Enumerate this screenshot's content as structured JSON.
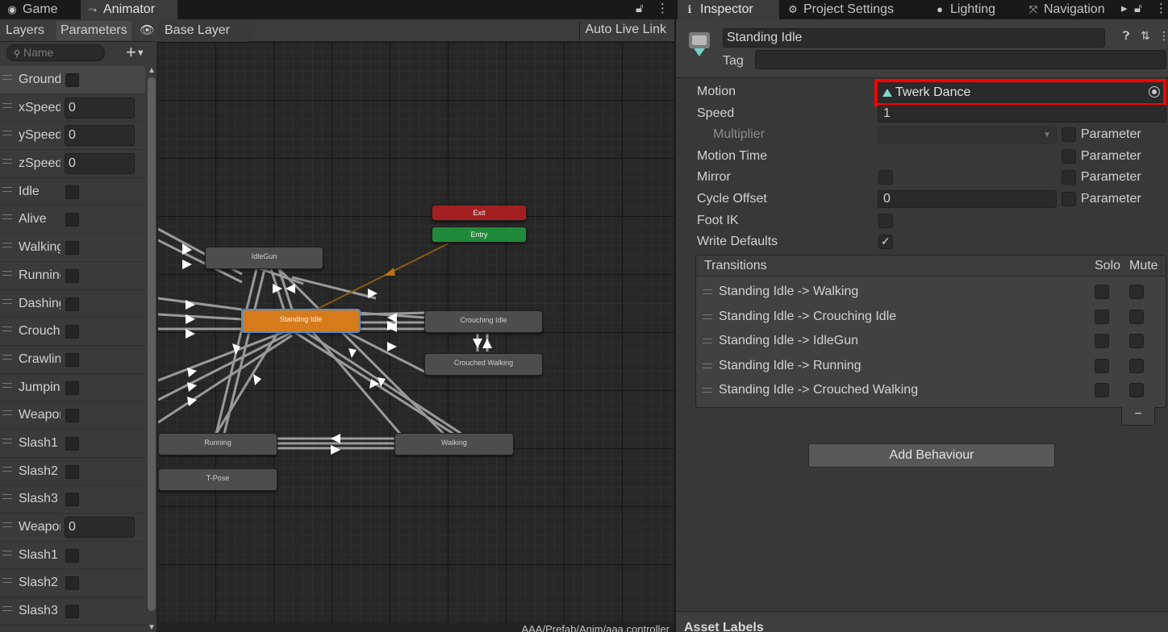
{
  "animator": {
    "tabs": [
      {
        "label": "Game",
        "icon": "gamepad-icon"
      },
      {
        "label": "Animator",
        "icon": "animator-icon"
      }
    ],
    "toolbar": {
      "layers_label": "Layers",
      "parameters_label": "Parameters",
      "breadcrumb": "Base Layer",
      "auto_live_link": "Auto Live Link"
    },
    "search_placeholder": "Name",
    "parameters": [
      {
        "name": "Ground",
        "type": "bool"
      },
      {
        "name": "xSpeed",
        "type": "float",
        "value": "0"
      },
      {
        "name": "ySpeed",
        "type": "float",
        "value": "0"
      },
      {
        "name": "zSpeed",
        "type": "float",
        "value": "0"
      },
      {
        "name": "Idle",
        "type": "bool"
      },
      {
        "name": "Alive",
        "type": "bool"
      },
      {
        "name": "Walking",
        "type": "bool"
      },
      {
        "name": "Running",
        "type": "bool"
      },
      {
        "name": "Dashing",
        "type": "bool"
      },
      {
        "name": "Crouching",
        "type": "bool"
      },
      {
        "name": "Crawling",
        "type": "bool"
      },
      {
        "name": "Jumping",
        "type": "bool"
      },
      {
        "name": "Weapon",
        "type": "bool"
      },
      {
        "name": "Slash1",
        "type": "bool"
      },
      {
        "name": "Slash2",
        "type": "bool"
      },
      {
        "name": "Slash3",
        "type": "bool"
      },
      {
        "name": "Weapon",
        "type": "float",
        "value": "0"
      },
      {
        "name": "Slash1",
        "type": "bool"
      },
      {
        "name": "Slash2",
        "type": "bool"
      },
      {
        "name": "Slash3",
        "type": "bool"
      }
    ],
    "states": {
      "exit": "Exit",
      "entry": "Entry",
      "idle_gun": "IdleGun",
      "standing_idle": "Standing Idle",
      "crouching_idle": "Crouching Idle",
      "crouched_walking": "Crouched Walking",
      "running": "Running",
      "walking": "Walking",
      "t_pose": "T-Pose"
    },
    "controller_path": "AAA/Prefab/Anim/aaa.controller"
  },
  "inspector": {
    "tabs": [
      {
        "label": "Inspector",
        "icon": "info-icon"
      },
      {
        "label": "Project Settings",
        "icon": "gear-icon"
      },
      {
        "label": "Lighting",
        "icon": "bulb-icon"
      },
      {
        "label": "Navigation",
        "icon": "navigation-icon"
      }
    ],
    "state_name": "Standing Idle",
    "tag_label": "Tag",
    "tag_value": "",
    "fields": {
      "motion_label": "Motion",
      "motion_value": "Twerk Dance",
      "speed_label": "Speed",
      "speed_value": "1",
      "multiplier_label": "Multiplier",
      "motion_time_label": "Motion Time",
      "mirror_label": "Mirror",
      "cycle_offset_label": "Cycle Offset",
      "cycle_offset_value": "0",
      "foot_ik_label": "Foot IK",
      "write_defaults_label": "Write Defaults",
      "write_defaults_checked": true,
      "parameter_label": "Parameter"
    },
    "transitions": {
      "header": "Transitions",
      "solo": "Solo",
      "mute": "Mute",
      "items": [
        "Standing Idle -> Walking",
        "Standing Idle -> Crouching Idle",
        "Standing Idle -> IdleGun",
        "Standing Idle -> Running",
        "Standing Idle -> Crouched Walking"
      ],
      "remove_label": "−"
    },
    "add_behaviour": "Add Behaviour",
    "asset_labels": "Asset Labels",
    "colors": {
      "highlight": "#ff0000",
      "default_state": "#d67b1b",
      "exit_state": "#a32021",
      "entry_state": "#1f8a3a"
    }
  }
}
